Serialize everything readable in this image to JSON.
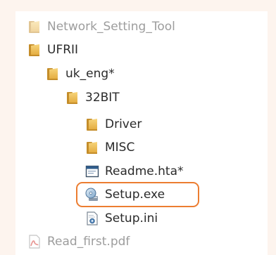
{
  "tree": {
    "items": [
      {
        "label": "Network_Setting_Tool",
        "icon": "folder-icon",
        "dimmed": true
      },
      {
        "label": "UFRII",
        "icon": "folder-icon",
        "dimmed": false
      },
      {
        "label": "uk_eng*",
        "icon": "folder-icon",
        "dimmed": false
      },
      {
        "label": "32BIT",
        "icon": "folder-icon",
        "dimmed": false
      },
      {
        "label": "Driver",
        "icon": "folder-icon",
        "dimmed": false
      },
      {
        "label": "MISC",
        "icon": "folder-icon",
        "dimmed": false
      },
      {
        "label": "Readme.hta*",
        "icon": "hta-window-icon",
        "dimmed": false
      },
      {
        "label": "Setup.exe",
        "icon": "setup-exe-icon",
        "dimmed": false,
        "highlighted": true
      },
      {
        "label": "Setup.ini",
        "icon": "settings-file-icon",
        "dimmed": false
      },
      {
        "label": "Read_first.pdf",
        "icon": "pdf-icon",
        "dimmed": true
      }
    ]
  },
  "colors": {
    "background": "#fdf4ee",
    "panel": "#ffffff",
    "highlight_border": "#ec7d31",
    "folder": "#e8b74a",
    "text": "#2a2a2a",
    "dimmed_text": "#9d9d9d"
  }
}
